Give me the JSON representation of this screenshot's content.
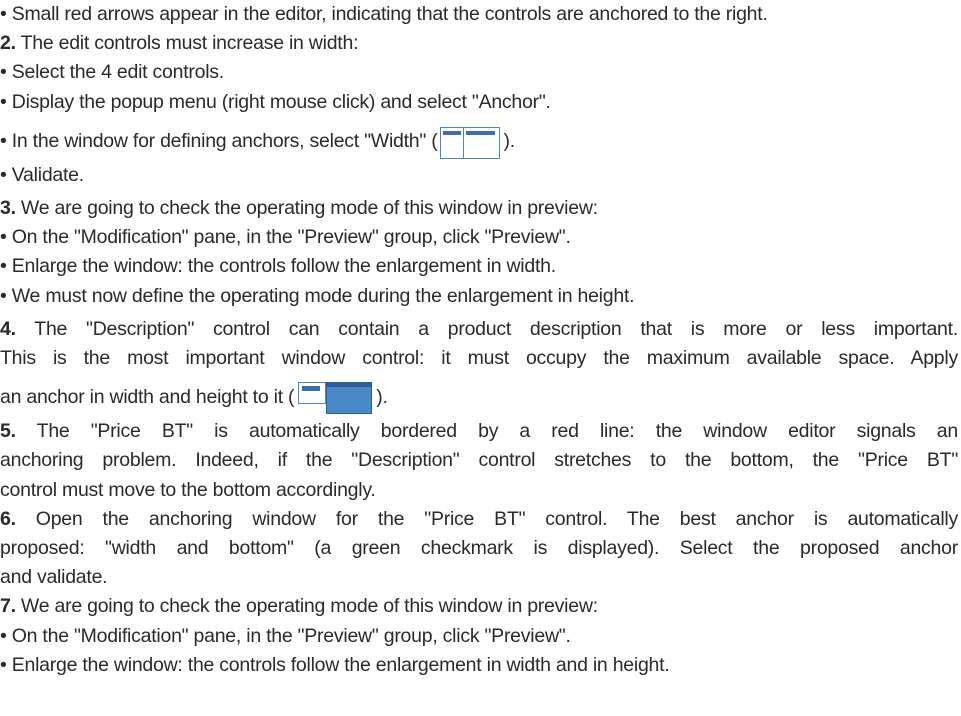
{
  "lines": [
    {
      "kind": "bullet",
      "text": "Small red arrows appear in the editor, indicating that the controls are anchored to the right."
    },
    {
      "kind": "step",
      "num": "2.",
      "text": " The edit controls must increase in width:"
    },
    {
      "kind": "bullet",
      "text": "Select the 4 edit controls."
    },
    {
      "kind": "bullet",
      "text": "Display the popup menu (right mouse click) and select \"Anchor\"."
    },
    {
      "kind": "bullet-icon",
      "before": "In the window for defining anchors, select \"Width\" (",
      "icon": "anchor-width-icon",
      "after": ")."
    },
    {
      "kind": "bullet",
      "text": "Validate."
    },
    {
      "kind": "step",
      "num": "3.",
      "text": " We are going to check the operating mode of this window in preview:"
    },
    {
      "kind": "bullet",
      "text": "On the \"Modification\" pane, in the \"Preview\" group, click \"Preview\"."
    },
    {
      "kind": "bullet",
      "text": "Enlarge the window: the controls follow the enlargement in width."
    },
    {
      "kind": "bullet",
      "text": "We must now define the operating mode during the enlargement in height."
    },
    {
      "kind": "step-just",
      "num": "4.",
      "text": " The \"Description\" control can contain a product description that is more or less important."
    },
    {
      "kind": "just",
      "text": "This is the most important window control: it must occupy the maximum available space. Apply"
    },
    {
      "kind": "icon-line",
      "before": "an anchor in width and height to it (",
      "icon": "anchor-width-height-icon",
      "after": ")."
    },
    {
      "kind": "step-just",
      "num": "5.",
      "text": " The \"Price BT\" is automatically bordered by a red line: the window editor signals an"
    },
    {
      "kind": "just",
      "text": "anchoring problem. Indeed, if the \"Description\" control stretches to the bottom, the \"Price BT\""
    },
    {
      "kind": "plain",
      "text": "control must move to the bottom accordingly."
    },
    {
      "kind": "step-just",
      "num": "6.",
      "text": " Open the anchoring window for the \"Price BT\" control. The best anchor is automatically"
    },
    {
      "kind": "just",
      "text": "proposed: \"width and bottom\" (a green checkmark is displayed). Select the proposed anchor"
    },
    {
      "kind": "plain",
      "text": "and validate."
    },
    {
      "kind": "step",
      "num": "7.",
      "text": " We are going to check the operating mode of this window in preview:"
    },
    {
      "kind": "bullet",
      "text": "On the \"Modification\" pane, in the \"Preview\" group, click \"Preview\"."
    },
    {
      "kind": "bullet",
      "text": "Enlarge the window: the controls follow the enlargement in width and in height."
    }
  ]
}
